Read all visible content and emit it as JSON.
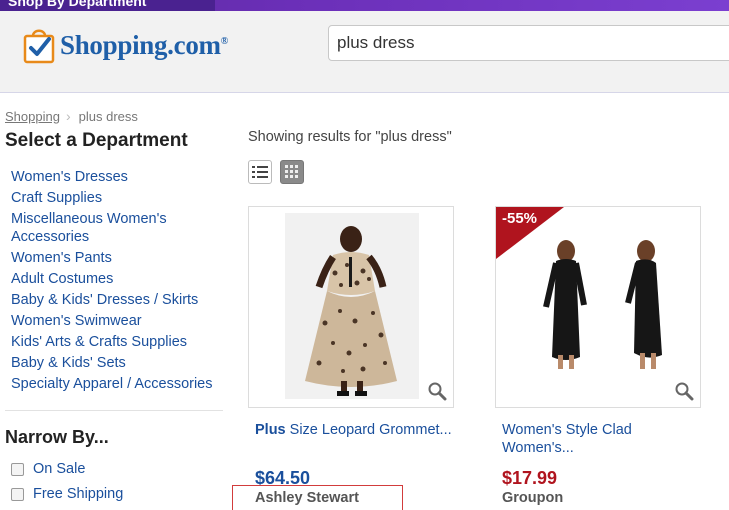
{
  "topbar": {
    "tab_label": "Shop By Department"
  },
  "header": {
    "logo_text": "Shopping.com",
    "logo_tm": "®",
    "search_value": "plus dress"
  },
  "breadcrumb": {
    "home": "Shopping",
    "current": "plus dress"
  },
  "sidebar": {
    "dept_title": "Select a Department",
    "departments": [
      "Women's Dresses",
      "Craft Supplies",
      "Miscellaneous Women's Accessories",
      "Women's Pants",
      "Adult Costumes",
      "Baby & Kids' Dresses / Skirts",
      "Women's Swimwear",
      "Kids' Arts & Crafts Supplies",
      "Baby & Kids' Sets",
      "Specialty Apparel / Accessories"
    ],
    "narrow_title": "Narrow By...",
    "filters": [
      "On Sale",
      "Free Shipping"
    ]
  },
  "results": {
    "showing_text": "Showing results for \"plus dress\""
  },
  "products": [
    {
      "title_bold": "Plus",
      "title_rest": " Size Leopard Grommet...",
      "price": "$64.50",
      "seller": "Ashley Stewart"
    },
    {
      "discount": "-55%",
      "title": "Women's Style Clad Women's...",
      "price": "$17.99",
      "seller": "Groupon"
    }
  ],
  "colors": {
    "accent_link": "#1a4f9c",
    "sale_red": "#b0141e",
    "topbar_purple": "#6b2fb8"
  }
}
